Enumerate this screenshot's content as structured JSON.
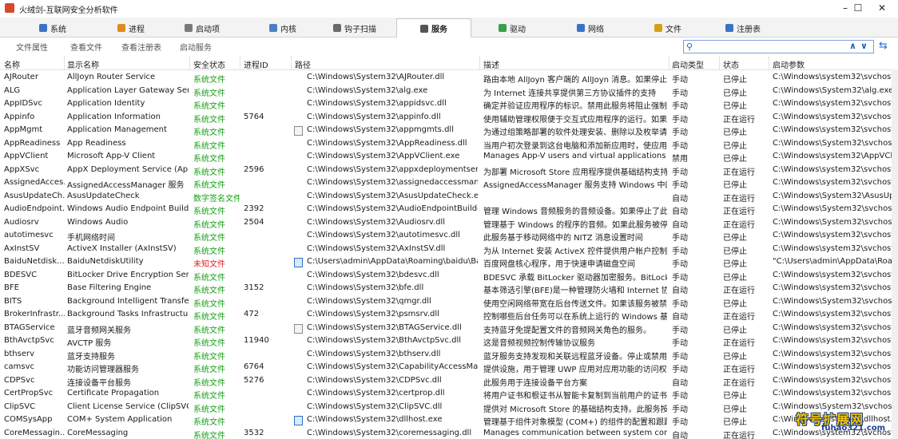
{
  "window": {
    "title": "火绒剑-互联网安全分析软件"
  },
  "tabs": [
    {
      "label": "系统",
      "icon": "monitor-icon",
      "color": "#3b73c4"
    },
    {
      "label": "进程",
      "icon": "windows-flag-icon",
      "color": "#e08a1e"
    },
    {
      "label": "启动项",
      "icon": "gear-icon",
      "color": "#7a7a7a"
    },
    {
      "label": "内核",
      "icon": "cpu-icon",
      "color": "#4a7fc6"
    },
    {
      "label": "钩子扫描",
      "icon": "hook-icon",
      "color": "#6a6a6a"
    },
    {
      "label": "服务",
      "icon": "service-gear-icon",
      "color": "#555555",
      "active": true
    },
    {
      "label": "驱动",
      "icon": "driver-icon",
      "color": "#3aa04a"
    },
    {
      "label": "网络",
      "icon": "network-icon",
      "color": "#3b73c4"
    },
    {
      "label": "文件",
      "icon": "folder-icon",
      "color": "#d4a017"
    },
    {
      "label": "注册表",
      "icon": "registry-icon",
      "color": "#3b73c4"
    }
  ],
  "toolbar": {
    "buttons": [
      "文件属性",
      "查看文件",
      "查看注册表",
      "启动服务"
    ]
  },
  "columns": [
    "名称",
    "显示名称",
    "安全状态",
    "进程ID",
    "路径",
    "描述",
    "启动类型",
    "状态",
    "启动参数"
  ],
  "rows": [
    [
      "AJRouter",
      "AllJoyn Router Service",
      "系统文件",
      "",
      "C:\\Windows\\System32\\AJRouter.dll",
      "路由本地 AllJoyn 客户端的 AllJoyn 消息。如果停止...",
      "手动",
      "已停止",
      "C:\\Windows\\system32\\svchost.e"
    ],
    [
      "ALG",
      "Application Layer Gateway Servi...",
      "系统文件",
      "",
      "C:\\Windows\\System32\\alg.exe",
      "为 Internet 连接共享提供第三方协议插件的支持",
      "手动",
      "已停止",
      "C:\\Windows\\System32\\alg.exe"
    ],
    [
      "AppIDSvc",
      "Application Identity",
      "系统文件",
      "",
      "C:\\Windows\\System32\\appidsvc.dll",
      "确定并验证应用程序的标识。禁用此服务将阻止强制...",
      "手动",
      "已停止",
      "C:\\Windows\\system32\\svchost.e"
    ],
    [
      "Appinfo",
      "Application Information",
      "系统文件",
      "5764",
      "C:\\Windows\\System32\\appinfo.dll",
      "使用辅助管理权限便于交互式应用程序的运行。如果...",
      "手动",
      "正在运行",
      "C:\\Windows\\system32\\svchost.e"
    ],
    [
      "AppMgmt",
      "Application Management",
      "系统文件",
      "",
      "C:\\Windows\\System32\\appmgmts.dll",
      "为通过组策略部署的软件处理安装、删除以及枚举请...",
      "手动",
      "已停止",
      "C:\\Windows\\system32\\svchost.e"
    ],
    [
      "AppReadiness",
      "App Readiness",
      "系统文件",
      "",
      "C:\\Windows\\System32\\AppReadiness.dll",
      "当用户初次登录到这台电脑和添加新应用时，使应用...",
      "手动",
      "已停止",
      "C:\\Windows\\System32\\svchost.e"
    ],
    [
      "AppVClient",
      "Microsoft App-V Client",
      "系统文件",
      "",
      "C:\\Windows\\System32\\AppVClient.exe",
      "Manages App-V users and virtual applications",
      "禁用",
      "已停止",
      "C:\\Windows\\system32\\AppVClie"
    ],
    [
      "AppXSvc",
      "AppX Deployment Service (App...",
      "系统文件",
      "2596",
      "C:\\Windows\\System32\\appxdeploymentserve...",
      "为部署 Microsoft Store 应用程序提供基础结构支持...",
      "手动",
      "正在运行",
      "C:\\Windows\\system32\\svchost.e"
    ],
    [
      "AssignedAcces...",
      "AssignedAccessManager 服务",
      "系统文件",
      "",
      "C:\\Windows\\System32\\assignedaccessmanag...",
      "AssignedAccessManager 服务支持 Windows 中的...",
      "手动",
      "已停止",
      "C:\\Windows\\system32\\svchost.e"
    ],
    [
      "AsusUpdateCh...",
      "AsusUpdateCheck",
      "数字签名文件",
      "",
      "C:\\Windows\\System32\\AsusUpdateCheck.exe",
      "",
      "自动",
      "正在运行",
      "C:\\Windows\\System32\\AsusUpc"
    ],
    [
      "AudioEndpoint...",
      "Windows Audio Endpoint Builder",
      "系统文件",
      "2392",
      "C:\\Windows\\System32\\AudioEndpointBuilder....",
      "管理 Windows 音频服务的音频设备。如果停止了此...",
      "自动",
      "正在运行",
      "C:\\Windows\\System32\\svchost.e"
    ],
    [
      "Audiosrv",
      "Windows Audio",
      "系统文件",
      "2504",
      "C:\\Windows\\System32\\Audiosrv.dll",
      "管理基于 Windows 的程序的音频。如果此服务被停...",
      "自动",
      "正在运行",
      "C:\\Windows\\System32\\svchost.e"
    ],
    [
      "autotimesvc",
      "手机网络时间",
      "系统文件",
      "",
      "C:\\Windows\\System32\\autotimesvc.dll",
      "此服务基于移动网络中的 NITZ 消息设置时间",
      "手动",
      "已停止",
      "C:\\Windows\\system32\\svchost.e"
    ],
    [
      "AxInstSV",
      "ActiveX Installer (AxInstSV)",
      "系统文件",
      "",
      "C:\\Windows\\System32\\AxInstSV.dll",
      "为从 Internet 安装 ActiveX 控件提供用户帐户控制验...",
      "手动",
      "已停止",
      "C:\\Windows\\system32\\svchost.e"
    ],
    [
      "BaiduNetdisk...",
      "BaiduNetdiskUtility",
      "未知文件",
      "",
      "C:\\Users\\admin\\AppData\\Roaming\\baidu\\Bai...",
      "百度网盘核心程序，用于快速申请磁盘空间",
      "手动",
      "已停止",
      "\"C:\\Users\\admin\\AppData\\Roar"
    ],
    [
      "BDESVC",
      "BitLocker Drive Encryption Servi...",
      "系统文件",
      "",
      "C:\\Windows\\System32\\bdesvc.dll",
      "BDESVC 承载 BitLocker 驱动器加密服务。BitLocke...",
      "手动",
      "已停止",
      "C:\\Windows\\system32\\svchost.e"
    ],
    [
      "BFE",
      "Base Filtering Engine",
      "系统文件",
      "3152",
      "C:\\Windows\\System32\\bfe.dll",
      "基本筛选引擎(BFE)是一种管理防火墙和 Internet 协议...",
      "自动",
      "正在运行",
      "C:\\Windows\\system32\\svchost.e"
    ],
    [
      "BITS",
      "Background Intelligent Transfer...",
      "系统文件",
      "",
      "C:\\Windows\\System32\\qmgr.dll",
      "使用空闲网络带宽在后台传送文件。如果该服务被禁...",
      "手动",
      "已停止",
      "C:\\Windows\\System32\\svchost.e"
    ],
    [
      "BrokerInfrastr...",
      "Background Tasks Infrastructur...",
      "系统文件",
      "472",
      "C:\\Windows\\System32\\psmsrv.dll",
      "控制哪些后台任务可以在系统上运行的 Windows 基...",
      "自动",
      "正在运行",
      "C:\\Windows\\system32\\svchost.e"
    ],
    [
      "BTAGService",
      "蓝牙音频网关服务",
      "系统文件",
      "",
      "C:\\Windows\\System32\\BTAGService.dll",
      "支持蓝牙免提配置文件的音频网关角色的服务。",
      "手动",
      "已停止",
      "C:\\Windows\\system32\\svchost.e"
    ],
    [
      "BthAvctpSvc",
      "AVCTP 服务",
      "系统文件",
      "11940",
      "C:\\Windows\\System32\\BthAvctpSvc.dll",
      "这是音频视频控制传输协议服务",
      "手动",
      "正在运行",
      "C:\\Windows\\system32\\svchost.e"
    ],
    [
      "bthserv",
      "蓝牙支持服务",
      "系统文件",
      "",
      "C:\\Windows\\System32\\bthserv.dll",
      "蓝牙服务支持发现和关联远程蓝牙设备。停止或禁用...",
      "手动",
      "已停止",
      "C:\\Windows\\system32\\svchost.e"
    ],
    [
      "camsvc",
      "功能访问管理器服务",
      "系统文件",
      "6764",
      "C:\\Windows\\System32\\CapabilityAccessMana...",
      "提供设施，用于管理 UWP 应用对应用功能的访问权...",
      "手动",
      "正在运行",
      "C:\\Windows\\system32\\svchost.e"
    ],
    [
      "CDPSvc",
      "连接设备平台服务",
      "系统文件",
      "5276",
      "C:\\Windows\\System32\\CDPSvc.dll",
      "此服务用于连接设备平台方案",
      "自动",
      "正在运行",
      "C:\\Windows\\system32\\svchost.e"
    ],
    [
      "CertPropSvc",
      "Certificate Propagation",
      "系统文件",
      "",
      "C:\\Windows\\System32\\certprop.dll",
      "将用户证书和根证书从智能卡复制到当前用户的证书...",
      "手动",
      "已停止",
      "C:\\Windows\\system32\\svchost.e"
    ],
    [
      "ClipSVC",
      "Client License Service (ClipSVC)",
      "系统文件",
      "",
      "C:\\Windows\\System32\\ClipSVC.dll",
      "提供对 Microsoft Store 的基础结构支持。此服务按...",
      "手动",
      "已停止",
      "C:\\Windows\\System32\\svchost.e"
    ],
    [
      "COMSysApp",
      "COM+ System Application",
      "系统文件",
      "",
      "C:\\Windows\\System32\\dllhost.exe",
      "管理基于组件对象模型 (COM+) 的组件的配置和跟踪...",
      "手动",
      "已停止",
      "C:\\Windows\\system32\\dllhost.e"
    ],
    [
      "CoreMessagin...",
      "CoreMessaging",
      "系统文件",
      "3532",
      "C:\\Windows\\System32\\coremessaging.dll",
      "Manages communication between system comp...",
      "自动",
      "正在运行",
      "C:\\Windows\\system32\\svchost.e"
    ]
  ],
  "watermark": {
    "text": "符号扩展网",
    "sub": "fuhao321.com"
  },
  "colors": {
    "system_file": "#17a017",
    "unknown_file": "#e02020",
    "accent": "#2b6cc4"
  }
}
